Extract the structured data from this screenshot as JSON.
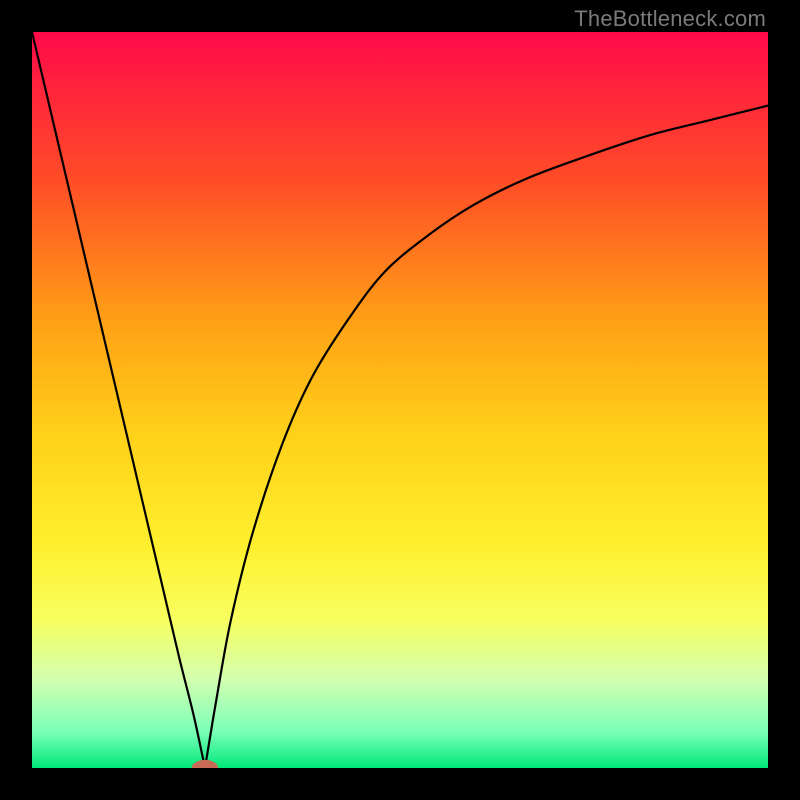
{
  "watermark": {
    "text": "TheBottleneck.com"
  },
  "chart_data": {
    "type": "line",
    "title": "",
    "xlabel": "",
    "ylabel": "",
    "xlim": [
      0,
      100
    ],
    "ylim": [
      0,
      100
    ],
    "grid": false,
    "legend": false,
    "gradient_bands": [
      {
        "position": 0.0,
        "color": "#ff0a49"
      },
      {
        "position": 0.2,
        "color": "#ff4c27"
      },
      {
        "position": 0.4,
        "color": "#ffa315"
      },
      {
        "position": 0.55,
        "color": "#ffd21a"
      },
      {
        "position": 0.7,
        "color": "#fff02f"
      },
      {
        "position": 0.8,
        "color": "#f7ff60"
      },
      {
        "position": 0.88,
        "color": "#d2ffb0"
      },
      {
        "position": 0.95,
        "color": "#7cffb8"
      },
      {
        "position": 1.0,
        "color": "#00e87a"
      }
    ],
    "series": [
      {
        "name": "left-branch",
        "x": [
          0,
          2,
          4,
          6,
          8,
          10,
          12,
          14,
          16,
          18,
          20,
          22,
          23.5
        ],
        "y": [
          100,
          91.5,
          83,
          74.5,
          66,
          57.5,
          49,
          40.5,
          32,
          23.5,
          15,
          7,
          0
        ]
      },
      {
        "name": "right-branch",
        "x": [
          23.5,
          25,
          27,
          30,
          34,
          38,
          43,
          48,
          54,
          60,
          67,
          75,
          84,
          92,
          100
        ],
        "y": [
          0,
          9,
          20,
          32,
          44,
          53,
          61,
          67.5,
          72.5,
          76.5,
          80,
          83,
          86,
          88,
          90
        ]
      }
    ],
    "marker": {
      "x": 23.5,
      "y": 0,
      "rx": 1.8,
      "ry": 1.1,
      "color": "#c76b56"
    }
  }
}
